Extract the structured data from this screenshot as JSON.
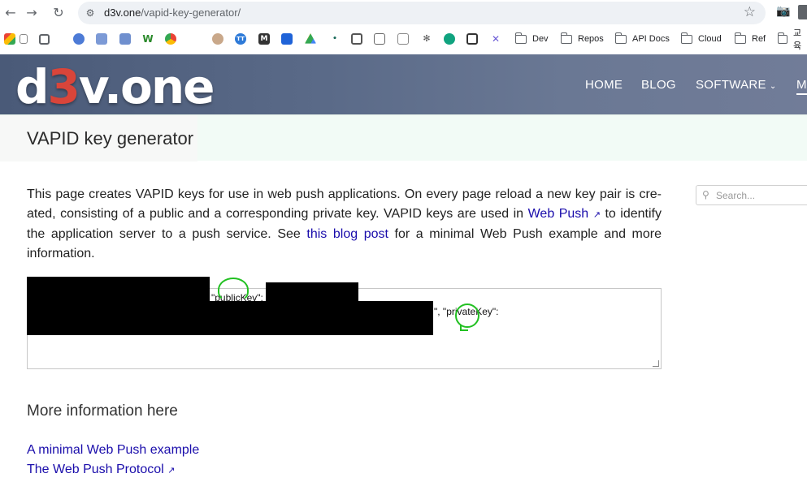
{
  "browser": {
    "url_host": "d3v.one",
    "url_path": "/vapid-key-generator/",
    "bookmarks": [
      {
        "label": "Dev"
      },
      {
        "label": "Repos"
      },
      {
        "label": "API Docs"
      },
      {
        "label": "Cloud"
      },
      {
        "label": "Ref"
      },
      {
        "label": "교육"
      }
    ],
    "bookmark_icon_letters": [
      "W",
      "M",
      "TT"
    ]
  },
  "site": {
    "logo_prefix": "d",
    "logo_three": "3",
    "logo_suffix": "v.one",
    "nav": {
      "home": "HOME",
      "blog": "BLOG",
      "software": "SOFTWARE",
      "more": "M"
    }
  },
  "page": {
    "title": "VAPID key generator",
    "intro_1": "This page creates VAPID keys for use in web push applications. On every page reload a new key pair is cre­ated, consisting of a public and a corresponding private key. VAPID keys are used in ",
    "webpush_link": "Web Push",
    "intro_2": " to identify the application server to a push service. See ",
    "blog_link": "this blog post",
    "intro_3": " for a minimal Web Push example and more information.",
    "key_public_label": "\"publicKey\":",
    "key_private_label": "\", \"privateKey\":",
    "more_heading": "More information here",
    "links": {
      "minimal": "A minimal Web Push example",
      "protocol": "The Web Push Protocol"
    }
  },
  "search": {
    "placeholder": "Search..."
  },
  "colors": {
    "header_bg": "#5a6a88",
    "logo_accent": "#d9453a",
    "link": "#1a0dab",
    "annotation": "#22c022"
  }
}
